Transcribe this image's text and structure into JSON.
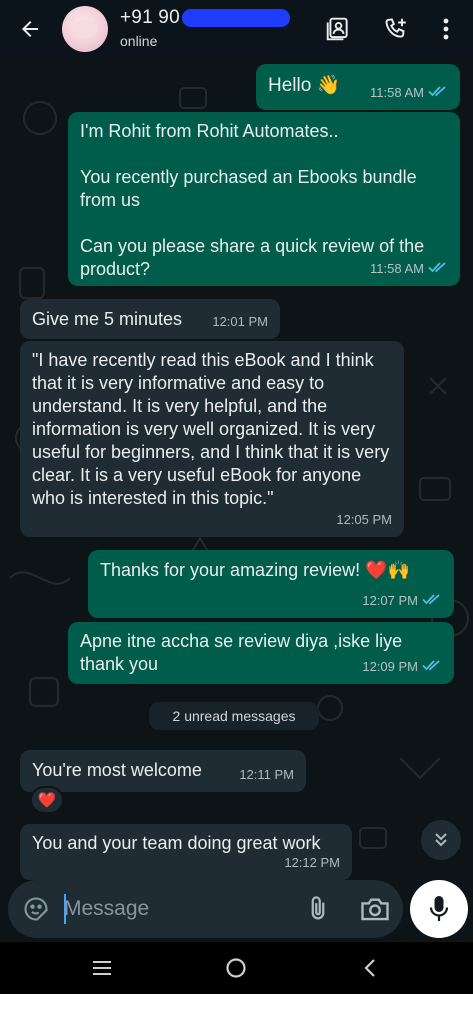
{
  "header": {
    "back_icon": "arrow-left-icon",
    "contact_name": "+91 90",
    "status": "online",
    "icons": [
      "contact-card-icon",
      "add-call-icon",
      "more-vertical-icon"
    ]
  },
  "messages": [
    {
      "text": "Hello 👋",
      "time": "11:58 AM",
      "direction": "outgoing",
      "read": true
    },
    {
      "text": "I'm Rohit from Rohit Automates..\n\nYou recently purchased an Ebooks bundle from us\n\nCan you please share a quick review of the product?",
      "time": "11:58 AM",
      "direction": "outgoing",
      "read": true
    },
    {
      "text": "Give me 5 minutes",
      "time": "12:01 PM",
      "direction": "incoming"
    },
    {
      "text": "\"I have recently read this eBook and I think that it is very informative and easy to understand. It is very helpful, and the information is very well organized. It is very useful for beginners, and I think that it is very clear. It is a very useful eBook for anyone who is interested in this topic.\"",
      "time": "12:05 PM",
      "direction": "incoming"
    },
    {
      "text": "Thanks for your amazing review! ❤️🙌",
      "time": "12:07 PM",
      "direction": "outgoing",
      "read": true
    },
    {
      "text": "Apne itne accha se review diya ,iske liye thank you",
      "time": "12:09 PM",
      "direction": "outgoing",
      "read": true
    },
    {
      "text": "You're most welcome",
      "time": "12:11 PM",
      "direction": "incoming"
    },
    {
      "text": "You and your team doing great work",
      "time": "12:12 PM",
      "direction": "incoming"
    }
  ],
  "unread_label": "2 unread messages",
  "reaction": "❤️",
  "composer": {
    "placeholder": "Message",
    "icons": [
      "sticker-icon",
      "paperclip-icon",
      "camera-icon",
      "mic-icon"
    ]
  },
  "colors": {
    "outgoing_bubble": "#005c4b",
    "incoming_bubble": "#202c33",
    "chat_background": "#0d1418",
    "read_tick": "#53bdeb"
  },
  "navbar": {
    "icons": [
      "recent-apps-icon",
      "home-icon",
      "back-nav-icon"
    ]
  }
}
